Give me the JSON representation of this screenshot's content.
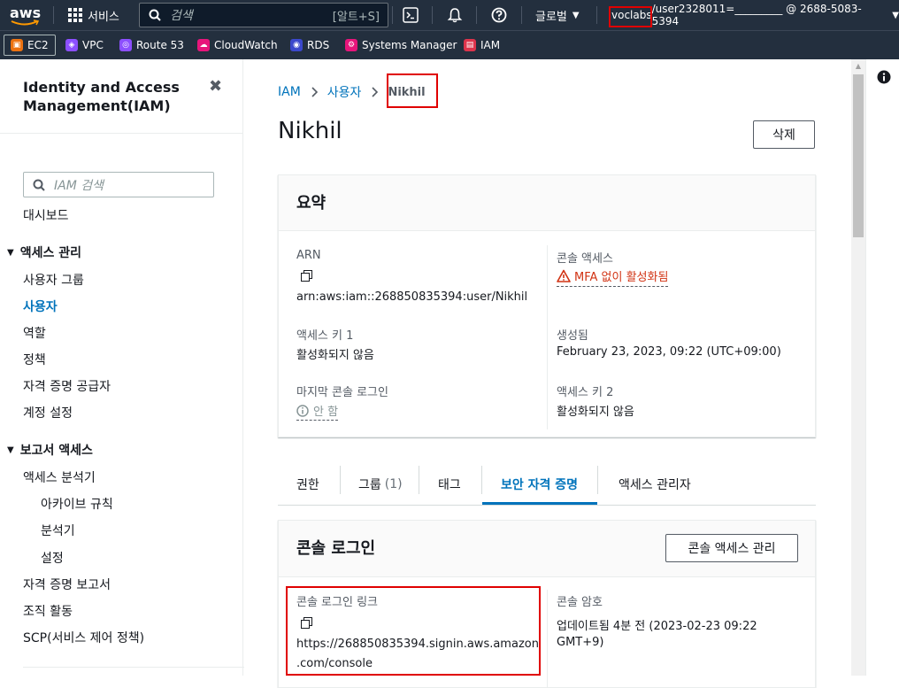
{
  "header": {
    "logo": "aws",
    "services_label": "서비스",
    "search_placeholder": "검색",
    "search_shortcut": "[알트+S]",
    "region": "글로벌",
    "account_user": "voclabs",
    "account_rest": "/user2328011=_________ @ 2688-5083-5394"
  },
  "service_bar": [
    {
      "label": "EC2",
      "color": "#ec7211"
    },
    {
      "label": "VPC",
      "color": "#8c4fff"
    },
    {
      "label": "Route 53",
      "color": "#8c4fff"
    },
    {
      "label": "CloudWatch",
      "color": "#e7157b"
    },
    {
      "label": "RDS",
      "color": "#3b48cc"
    },
    {
      "label": "Systems Manager",
      "color": "#e7157b"
    },
    {
      "label": "IAM",
      "color": "#dd344c"
    }
  ],
  "sidebar": {
    "title_line1": "Identity and Access",
    "title_line2": "Management(IAM)",
    "search_placeholder": "IAM 검색",
    "dashboard": "대시보드",
    "section1": "액세스 관리",
    "items1": [
      "사용자 그룹",
      "사용자",
      "역할",
      "정책",
      "자격 증명 공급자",
      "계정 설정"
    ],
    "section2": "보고서 액세스",
    "items2": [
      "액세스 분석기",
      "아카이브 규칙",
      "분석기",
      "설정",
      "자격 증명 보고서",
      "조직 활동",
      "SCP(서비스 제어 정책)"
    ]
  },
  "breadcrumb": {
    "root": "IAM",
    "mid": "사용자",
    "current": "Nikhil"
  },
  "page": {
    "title": "Nikhil",
    "delete_button": "삭제"
  },
  "summary": {
    "title": "요약",
    "arn_label": "ARN",
    "arn_value": "arn:aws:iam::268850835394:user/Nikhil",
    "console_access_label": "콘솔 액세스",
    "console_access_value": "MFA 없이 활성화됨",
    "key1_label": "액세스 키 1",
    "key1_value": "활성화되지 않음",
    "created_label": "생성됨",
    "created_value": "February 23, 2023, 09:22 (UTC+09:00)",
    "last_login_label": "마지막 콘솔 로그인",
    "last_login_value": "안 함",
    "key2_label": "액세스 키 2",
    "key2_value": "활성화되지 않음"
  },
  "tabs": [
    {
      "label": "권한"
    },
    {
      "label": "그룹",
      "count": "(1)"
    },
    {
      "label": "태그"
    },
    {
      "label": "보안 자격 증명"
    },
    {
      "label": "액세스 관리자"
    }
  ],
  "console_login": {
    "title": "콘솔 로그인",
    "manage_button": "콘솔 액세스 관리",
    "link_label": "콘솔 로그인 링크",
    "link_line1": "https://268850835394.signin.aws.amazon",
    "link_line2": ".com/console",
    "password_label": "콘솔 암호",
    "password_line1": "업데이트됨 4분 전 (2023-02-23 09:22",
    "password_line2": "GMT+9)"
  }
}
